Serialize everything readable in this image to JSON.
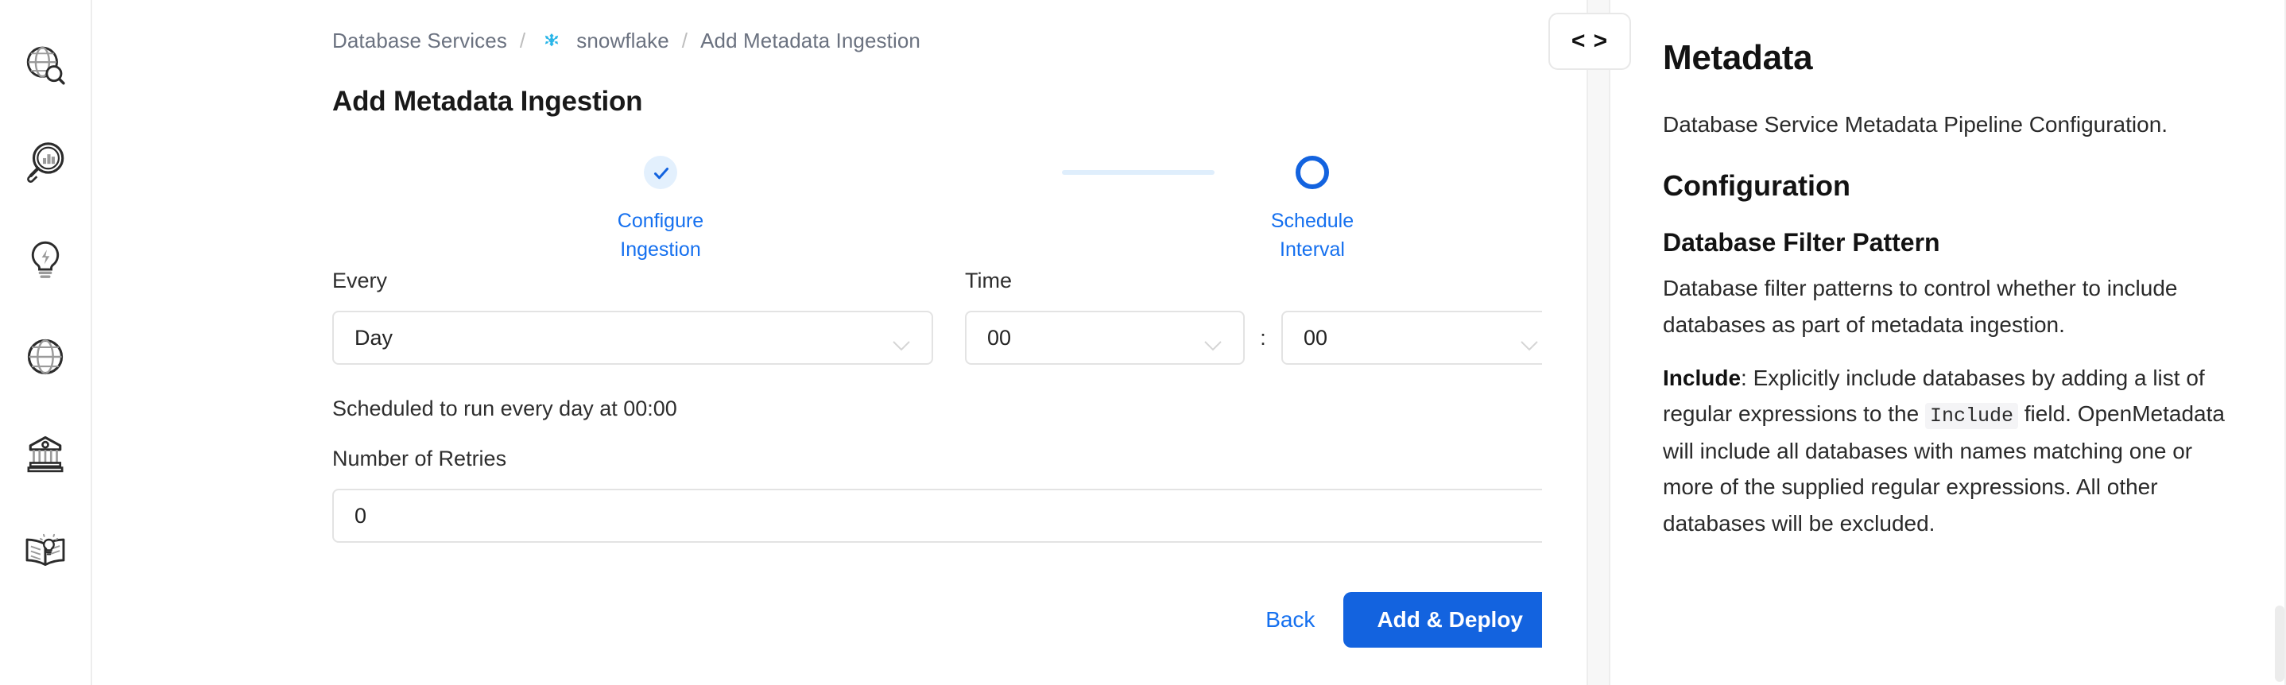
{
  "sidebar": {
    "items": [
      {
        "name": "explore",
        "icon": "globe-search-icon"
      },
      {
        "name": "insights",
        "icon": "magnifier-chart-icon"
      },
      {
        "name": "quality",
        "icon": "lightbulb-bolt-icon"
      },
      {
        "name": "domains",
        "icon": "globe-icon"
      },
      {
        "name": "governance",
        "icon": "bank-icon"
      },
      {
        "name": "glossary",
        "icon": "open-book-lightbulb-icon"
      }
    ]
  },
  "breadcrumb": {
    "root": "Database Services",
    "separator": "/",
    "service": "snowflake",
    "service_icon": "snowflake-icon",
    "current": "Add Metadata Ingestion"
  },
  "page": {
    "title": "Add Metadata Ingestion"
  },
  "stepper": {
    "steps": [
      {
        "label": "Configure\nIngestion",
        "state": "done",
        "icon": "check-icon"
      },
      {
        "label": "Schedule Interval",
        "state": "active",
        "icon": "circle-icon"
      }
    ]
  },
  "form": {
    "every_label": "Every",
    "every_value": "Day",
    "time_label": "Time",
    "hour_value": "00",
    "minute_value": "00",
    "time_separator": ":",
    "schedule_note": "Scheduled to run every day at 00:00",
    "retries_label": "Number of Retries",
    "retries_value": "0"
  },
  "actions": {
    "back_label": "Back",
    "submit_label": "Add & Deploy"
  },
  "gutter": {
    "code_toggle_label": "< >"
  },
  "doc": {
    "title": "Metadata",
    "intro": "Database Service Metadata Pipeline Configuration.",
    "section_heading": "Configuration",
    "subsection_heading": "Database Filter Pattern",
    "subsection_body": "Database filter patterns to control whether to include databases as part of metadata ingestion.",
    "include_label": "Include",
    "include_body_part1": ": Explicitly include databases by adding a list of regular expressions to the ",
    "include_code": "Include",
    "include_body_part2": " field. OpenMetadata will include all databases with names matching one or more of the supplied regular expressions. All other databases will be excluded."
  },
  "colors": {
    "accent": "#1363DF",
    "link": "#1570EF",
    "step_track": "#dfeefc",
    "step_done_bg": "#e3f0fd",
    "snowflake": "#29B5E8",
    "text": "#2e2e2e",
    "muted": "#6b7280",
    "border": "#e3e3e3"
  }
}
